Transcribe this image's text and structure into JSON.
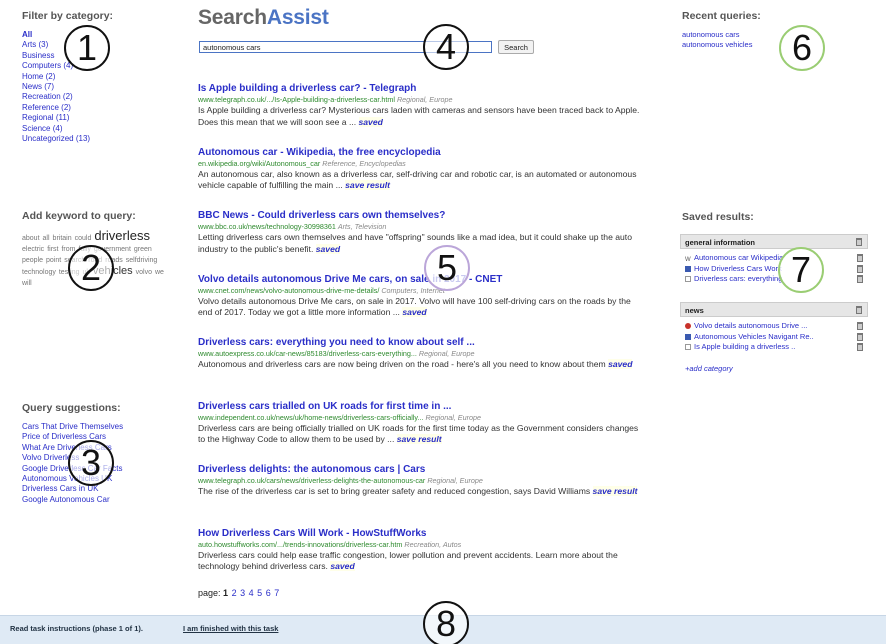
{
  "logo": {
    "part1": "Search",
    "part2": "Assist"
  },
  "search": {
    "value": "autonomous cars",
    "button": "Search"
  },
  "categories": {
    "heading": "Filter by category:",
    "items": [
      {
        "label": "All",
        "count": ""
      },
      {
        "label": "Arts",
        "count": "(3)"
      },
      {
        "label": "Business",
        "count": ""
      },
      {
        "label": "Computers",
        "count": "(4)"
      },
      {
        "label": "Home",
        "count": "(2)"
      },
      {
        "label": "News",
        "count": "(7)"
      },
      {
        "label": "Recreation",
        "count": "(2)"
      },
      {
        "label": "Reference",
        "count": "(2)"
      },
      {
        "label": "Regional",
        "count": "(11)"
      },
      {
        "label": "Science",
        "count": "(4)"
      },
      {
        "label": "Uncategorized",
        "count": "(13)"
      }
    ]
  },
  "keywords": {
    "heading": "Add keyword to query:",
    "words": [
      {
        "w": "about",
        "s": "sm"
      },
      {
        "w": "all",
        "s": "sm"
      },
      {
        "w": "britain",
        "s": "sm"
      },
      {
        "w": "could",
        "s": "sm"
      },
      {
        "w": "driverless",
        "s": "xl"
      },
      {
        "w": "electric",
        "s": "sm"
      },
      {
        "w": "first",
        "s": "sm"
      },
      {
        "w": "from",
        "s": "sm"
      },
      {
        "w": "fully",
        "s": "sm"
      },
      {
        "w": "government",
        "s": "sm"
      },
      {
        "w": "green",
        "s": "sm"
      },
      {
        "w": "people",
        "s": "sm"
      },
      {
        "w": "point",
        "s": "sm"
      },
      {
        "w": "search",
        "s": "sm"
      },
      {
        "w": "road",
        "s": "sm"
      },
      {
        "w": "roads",
        "s": "sm"
      },
      {
        "w": "selfdriving",
        "s": "sm"
      },
      {
        "w": "technology",
        "s": "sm"
      },
      {
        "w": "testing",
        "s": "sm"
      },
      {
        "w": "uk",
        "s": "sm"
      },
      {
        "w": "vehicles",
        "s": "lg"
      },
      {
        "w": "volvo",
        "s": "sm"
      },
      {
        "w": "we",
        "s": "sm"
      },
      {
        "w": "will",
        "s": "sm"
      }
    ]
  },
  "suggestions": {
    "heading": "Query suggestions:",
    "items": [
      "Cars That Drive Themselves",
      "Price of Driverless Cars",
      "What Are Driverless Cars",
      "Volvo Driverless",
      "Google Driverless Car Facts",
      "Autonomous Vehicles UK",
      "Driverless Cars in UK",
      "Google Autonomous Car"
    ]
  },
  "results": [
    {
      "title": "Is Apple building a driverless car? - Telegraph",
      "url": "www.telegraph.co.uk/.../Is-Apple-building-a-driverless-car.html",
      "meta": "Regional, Europe",
      "snippet": "Is Apple building a driverless car? Mysterious cars laden with cameras and sensors have been traced back to Apple. Does this mean that we will soon see a ...",
      "action": "saved"
    },
    {
      "title": "Autonomous car - Wikipedia, the free encyclopedia",
      "url": "en.wikipedia.org/wiki/Autonomous_car",
      "meta": "Reference, Encyclopedias",
      "snippet": "An autonomous car, also known as a driverless car, self-driving car and robotic car, is an automated or autonomous vehicle capable of fulfilling the main ...",
      "action": "save result"
    },
    {
      "title": "BBC News - Could driverless cars own themselves?",
      "url": "www.bbc.co.uk/news/technology-30998361",
      "meta": "Arts, Television",
      "snippet": "Letting driverless cars own themselves and have \"offspring\" sounds like a mad idea, but it could shake up the auto industry to the public's benefit.",
      "action": "saved"
    },
    {
      "title": "Volvo details autonomous Drive Me cars, on sale in 2017 - CNET",
      "url": "www.cnet.com/news/volvo-autonomous-drive-me-details/",
      "meta": "Computers, Internet",
      "snippet": "Volvo details autonomous Drive Me cars, on sale in 2017. Volvo will have 100 self-driving cars on the roads by the end of 2017. Today we got a little more information ...",
      "action": "saved"
    },
    {
      "title": "Driverless cars: everything you need to know about self ...",
      "url": "www.autoexpress.co.uk/car-news/85183/driverless-cars-everything...",
      "meta": "Regional, Europe",
      "snippet": "Autonomous and driverless cars are now being driven on the road - here's all you need to know about them",
      "action": "saved"
    },
    {
      "title": "Driverless cars trialled on UK roads for first time in ...",
      "url": "www.independent.co.uk/news/uk/home-news/driverless-cars-officially...",
      "meta": "Regional, Europe",
      "snippet": "Driverless cars are being officially trialled on UK roads for the first time today as the Government considers changes to the Highway Code to allow them to be used by ...",
      "action": "save result"
    },
    {
      "title": "Driverless delights: the autonomous cars | Cars",
      "url": "www.telegraph.co.uk/cars/news/driverless-delights-the-autonomous-car",
      "meta": "Regional, Europe",
      "snippet": "The rise of the driverless car is set to bring greater safety and reduced congestion, says David Williams",
      "action": "save result"
    },
    {
      "title": "How Driverless Cars Will Work - HowStuffWorks",
      "url": "auto.howstuffworks.com/.../trends-innovations/driverless-car.htm",
      "meta": "Recreation, Autos",
      "snippet": "Driverless cars could help ease traffic congestion, lower pollution and prevent accidents. Learn more about the technology behind driverless cars.",
      "action": "saved"
    }
  ],
  "pager": {
    "label": "page:",
    "pages": [
      "1",
      "2",
      "3",
      "4",
      "5",
      "6",
      "7"
    ]
  },
  "recent": {
    "heading": "Recent queries:",
    "items": [
      "autonomous cars",
      "autonomous vehicles"
    ]
  },
  "saved": {
    "heading": "Saved results:",
    "folders": [
      {
        "name": "general information",
        "items": [
          {
            "icon": "W",
            "label": "Autonomous car Wikipedia"
          },
          {
            "icon": "blue",
            "label": "How Driverless Cars Work"
          },
          {
            "icon": "doc",
            "label": "Driverless cars: everything"
          }
        ]
      },
      {
        "name": "news",
        "items": [
          {
            "icon": "red",
            "label": "Volvo details autonomous Drive ..."
          },
          {
            "icon": "blue",
            "label": "Autonomous Vehicles Navigant Re.."
          },
          {
            "icon": "doc",
            "label": "Is Apple building a driverless .."
          }
        ]
      }
    ],
    "add_category": "+add category"
  },
  "footer": {
    "instructions": "Read task instructions (phase 1 of 1).",
    "finish": "I am finished with this task"
  },
  "markers": [
    "1",
    "2",
    "3",
    "4",
    "5",
    "6",
    "7",
    "8"
  ],
  "colors": {
    "link": "#2a2ec8",
    "url": "#2e8a2e",
    "logo_accent": "#4b74c4",
    "footer_bg": "#dfeaf5",
    "marker_ring": "#9acd73"
  }
}
